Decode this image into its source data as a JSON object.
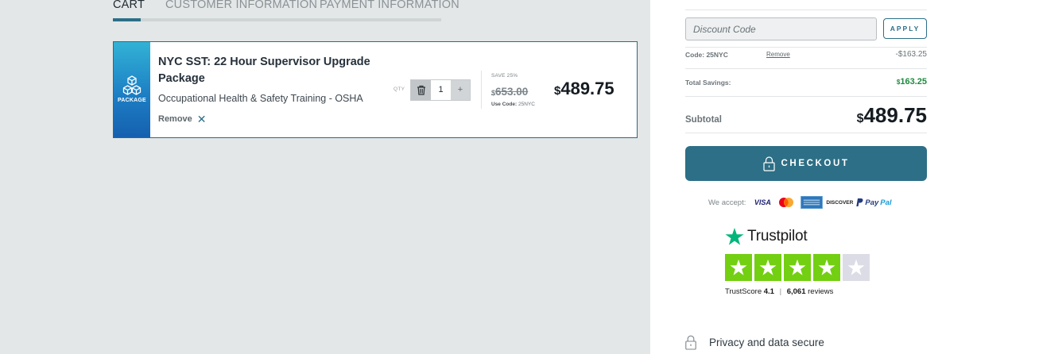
{
  "steps": [
    {
      "label": "CART",
      "active": true
    },
    {
      "label": "CUSTOMER INFORMATION",
      "active": false
    },
    {
      "label": "PAYMENT INFORMATION",
      "active": false
    }
  ],
  "cart_item": {
    "badge": "PACKAGE",
    "title": "NYC SST: 22 Hour Supervisor Upgrade Package",
    "subtitle": "Occupational Health & Safety Training - OSHA",
    "remove_label": "Remove",
    "qty_label": "QTY",
    "qty_value": "1",
    "plus_label": "+",
    "save_label": "SAVE 25%",
    "currency": "$",
    "old_price": "653.00",
    "use_code_label": "Use Code:",
    "use_code_value": "25NYC",
    "price": "489.75"
  },
  "summary": {
    "discount_placeholder": "Discount Code",
    "apply_label": "APPLY",
    "code_label": "Code: 25NYC",
    "code_remove": "Remove",
    "code_amount": "-$163.25",
    "savings_label": "Total Savings:",
    "savings_currency": "$",
    "savings_amount": "163.25",
    "subtotal_label": "Subtotal",
    "subtotal_currency": "$",
    "subtotal_amount": "489.75",
    "checkout_label": "CHECKOUT",
    "accept_label": "We accept:",
    "visa_label": "VISA",
    "discover_label": "DISCOVER",
    "paypal_pay": "Pay",
    "paypal_pal": "Pal",
    "privacy_label": "Privacy and data secure"
  },
  "trustpilot": {
    "brand": "Trustpilot",
    "score_label": "TrustScore",
    "score": "4.1",
    "separator": "|",
    "reviews_count": "6,061",
    "reviews_label": "reviews",
    "stars_filled": 4,
    "stars_total": 5,
    "star_color": "#73cf11"
  },
  "colors": {
    "accent": "#2d6f86",
    "savings": "#1f8a3e",
    "left_bg": "#e3e7e7"
  }
}
